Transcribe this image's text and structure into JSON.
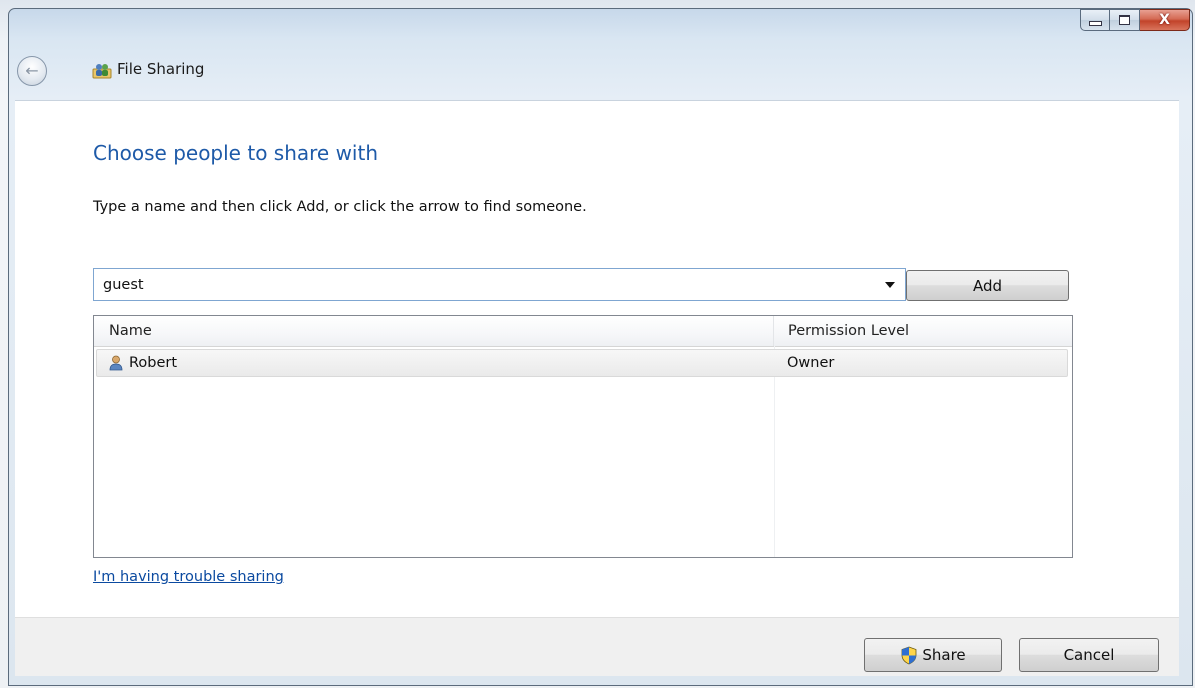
{
  "window": {
    "title": "File Sharing",
    "controls": {
      "minimize": "minimize",
      "maximize": "maximize",
      "close": "X"
    }
  },
  "dialog": {
    "heading": "Choose people to share with",
    "instruction": "Type a name and then click Add, or click the arrow to find someone.",
    "name_input": {
      "value": "guest"
    },
    "add_button": "Add",
    "list": {
      "columns": [
        "Name",
        "Permission Level"
      ],
      "rows": [
        {
          "name": "Robert",
          "permission": "Owner",
          "icon": "user-icon"
        }
      ]
    },
    "help_link": "I'm having trouble sharing",
    "share_button": "Share",
    "cancel_button": "Cancel"
  },
  "colors": {
    "heading": "#1e5aa8",
    "link": "#0b4aa0",
    "close_button": "#c2432a"
  }
}
